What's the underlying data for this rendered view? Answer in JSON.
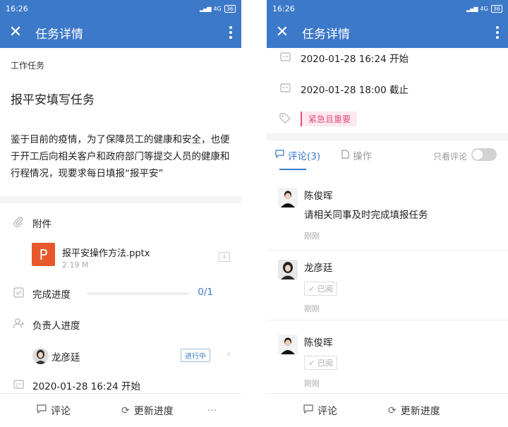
{
  "status_bar": {
    "time": "16:26",
    "network": "4G",
    "battery": "36"
  },
  "appbar": {
    "title": "任务详情"
  },
  "left": {
    "task_type": "工作任务",
    "task_title": "报平安填写任务",
    "description": "鉴于目前的疫情，为了保障员工的健康和安全，也便于开工后向相关客户和政府部门等提交人员的健康和行程情况，现要求每日填报“报平安”",
    "attachment_label": "附件",
    "attachment": {
      "name": "报平安操作方法.pptx",
      "size": "2.19 M",
      "type_letter": "P"
    },
    "progress_label": "完成进度",
    "progress_value": "0/1",
    "progress_fraction": 0,
    "owner_progress_label": "负责人进度",
    "owner": {
      "name": "龙彦廷",
      "status": "进行中"
    },
    "start_date": "2020-01-28 16:24 开始"
  },
  "right": {
    "start_date": "2020-01-28 16:24 开始",
    "due_date": "2020-01-28 18:00 截止",
    "priority_tag": "紧急且重要",
    "tabs": {
      "comments": "评论(3)",
      "ops": "操作"
    },
    "only_comments_label": "只看评论",
    "comments": [
      {
        "name": "陈俊晖",
        "text": "请相关同事及时完成填报任务",
        "time": "刚刚"
      },
      {
        "name": "龙彦廷",
        "read": "已阅",
        "time": "刚刚"
      },
      {
        "name": "陈俊晖",
        "read": "已阅",
        "time": "刚刚"
      }
    ]
  },
  "bottom_bar": {
    "comment_label": "评论",
    "update_label": "更新进度",
    "more": "···"
  },
  "colors": {
    "primary": "#3d79c9",
    "tag_text": "#e0507a",
    "tag_bg": "#fde9ef",
    "file_icon": "#e8582c"
  }
}
